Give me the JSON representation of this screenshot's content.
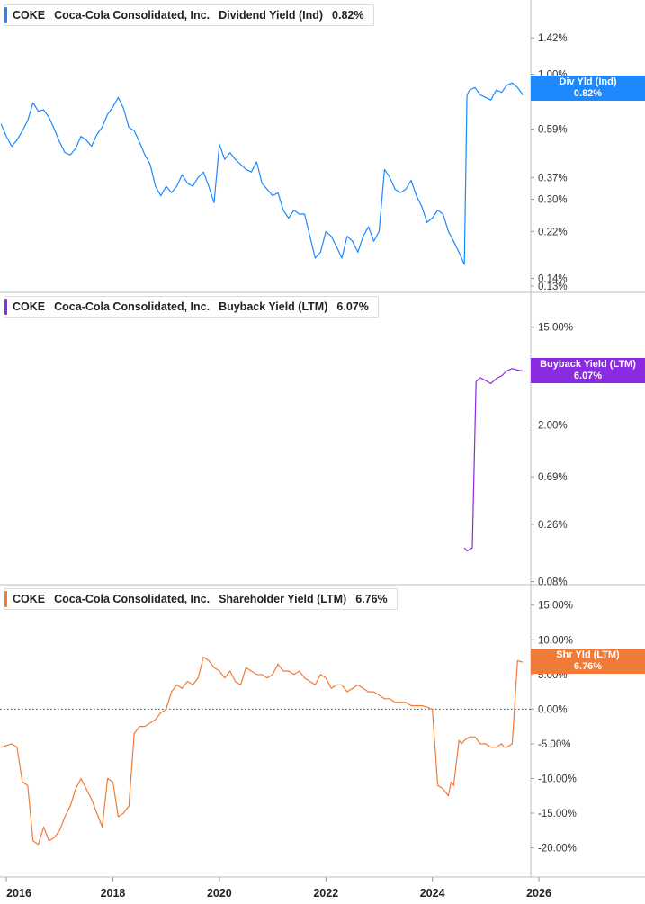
{
  "ticker": "COKE",
  "company": "Coca-Cola Consolidated, Inc.",
  "colors": {
    "div": "#1e88ff",
    "buyback": "#8a2be2",
    "shareholder": "#f07a38"
  },
  "panels": [
    {
      "metric": "Dividend Yield (Ind)",
      "value": "0.82%",
      "badge_line1": "Div Yld (Ind)",
      "badge_line2": "0.82%"
    },
    {
      "metric": "Buyback Yield (LTM)",
      "value": "6.07%",
      "badge_line1": "Buyback Yield (LTM)",
      "badge_line2": "6.07%"
    },
    {
      "metric": "Shareholder Yield (LTM)",
      "value": "6.76%",
      "badge_line1": "Shr Yld (LTM)",
      "badge_line2": "6.76%"
    }
  ],
  "chart_data": [
    {
      "type": "line",
      "title": "Dividend Yield (Ind)",
      "scale": "log",
      "ylim": [
        0.13,
        1.75
      ],
      "yticks": [
        "1.42%",
        "1.00%",
        "0.81%",
        "0.59%",
        "0.37%",
        "0.30%",
        "0.22%",
        "0.14%",
        "0.13%"
      ],
      "ytick_values": [
        1.42,
        1.0,
        0.81,
        0.59,
        0.37,
        0.3,
        0.22,
        0.14,
        0.13
      ],
      "last_value": 0.82,
      "x": [
        2015.9,
        2016.0,
        2016.1,
        2016.2,
        2016.3,
        2016.4,
        2016.5,
        2016.6,
        2016.7,
        2016.8,
        2016.9,
        2017.0,
        2017.1,
        2017.2,
        2017.3,
        2017.4,
        2017.5,
        2017.6,
        2017.7,
        2017.8,
        2017.9,
        2018.0,
        2018.1,
        2018.2,
        2018.3,
        2018.4,
        2018.5,
        2018.6,
        2018.7,
        2018.8,
        2018.9,
        2019.0,
        2019.1,
        2019.2,
        2019.3,
        2019.4,
        2019.5,
        2019.6,
        2019.7,
        2019.8,
        2019.9,
        2020.0,
        2020.1,
        2020.2,
        2020.3,
        2020.4,
        2020.5,
        2020.6,
        2020.7,
        2020.8,
        2020.9,
        2021.0,
        2021.1,
        2021.2,
        2021.3,
        2021.4,
        2021.5,
        2021.6,
        2021.7,
        2021.8,
        2021.9,
        2022.0,
        2022.1,
        2022.2,
        2022.3,
        2022.4,
        2022.5,
        2022.6,
        2022.7,
        2022.8,
        2022.9,
        2023.0,
        2023.1,
        2023.2,
        2023.3,
        2023.4,
        2023.5,
        2023.6,
        2023.7,
        2023.8,
        2023.9,
        2024.0,
        2024.1,
        2024.2,
        2024.3,
        2024.4,
        2024.5,
        2024.6,
        2024.65,
        2024.7,
        2024.8,
        2024.9,
        2025.0,
        2025.1,
        2025.2,
        2025.3,
        2025.4,
        2025.5,
        2025.6,
        2025.7
      ],
      "y": [
        0.62,
        0.55,
        0.5,
        0.53,
        0.58,
        0.64,
        0.76,
        0.7,
        0.71,
        0.66,
        0.59,
        0.52,
        0.47,
        0.46,
        0.49,
        0.55,
        0.53,
        0.5,
        0.56,
        0.6,
        0.68,
        0.73,
        0.8,
        0.72,
        0.6,
        0.58,
        0.52,
        0.46,
        0.42,
        0.34,
        0.31,
        0.34,
        0.32,
        0.34,
        0.38,
        0.35,
        0.34,
        0.37,
        0.39,
        0.34,
        0.29,
        0.51,
        0.44,
        0.47,
        0.44,
        0.42,
        0.4,
        0.39,
        0.43,
        0.35,
        0.33,
        0.31,
        0.32,
        0.27,
        0.25,
        0.27,
        0.26,
        0.26,
        0.21,
        0.17,
        0.18,
        0.22,
        0.21,
        0.19,
        0.17,
        0.21,
        0.2,
        0.18,
        0.21,
        0.23,
        0.2,
        0.22,
        0.4,
        0.37,
        0.33,
        0.32,
        0.33,
        0.36,
        0.31,
        0.28,
        0.24,
        0.25,
        0.27,
        0.26,
        0.22,
        0.2,
        0.18,
        0.16,
        0.82,
        0.86,
        0.88,
        0.82,
        0.8,
        0.78,
        0.86,
        0.84,
        0.9,
        0.92,
        0.88,
        0.82
      ]
    },
    {
      "type": "line",
      "title": "Buyback Yield (LTM)",
      "scale": "log",
      "ylim": [
        0.075,
        22
      ],
      "yticks": [
        "15.00%",
        "2.00%",
        "0.69%",
        "0.26%",
        "0.08%"
      ],
      "ytick_values": [
        15.0,
        2.0,
        0.69,
        0.26,
        0.08
      ],
      "last_value": 6.07,
      "x": [
        2024.6,
        2024.65,
        2024.7,
        2024.75,
        2024.82,
        2024.9,
        2025.0,
        2025.1,
        2025.2,
        2025.3,
        2025.4,
        2025.5,
        2025.6,
        2025.7
      ],
      "y": [
        0.16,
        0.15,
        0.155,
        0.16,
        4.9,
        5.3,
        5.0,
        4.7,
        5.2,
        5.5,
        6.1,
        6.4,
        6.2,
        6.07
      ]
    },
    {
      "type": "line",
      "title": "Shareholder Yield (LTM)",
      "ylim": [
        -22,
        16
      ],
      "yticks": [
        "15.00%",
        "10.00%",
        "5.00%",
        "0.00%",
        "-5.00%",
        "-10.00%",
        "-15.00%",
        "-20.00%"
      ],
      "ytick_values": [
        15,
        10,
        5,
        0,
        -5,
        -10,
        -15,
        -20
      ],
      "last_value": 6.76,
      "x": [
        2015.9,
        2016.1,
        2016.2,
        2016.3,
        2016.4,
        2016.5,
        2016.6,
        2016.7,
        2016.8,
        2016.9,
        2017.0,
        2017.1,
        2017.2,
        2017.3,
        2017.4,
        2017.5,
        2017.6,
        2017.7,
        2017.8,
        2017.9,
        2018.0,
        2018.1,
        2018.2,
        2018.3,
        2018.4,
        2018.5,
        2018.6,
        2018.7,
        2018.8,
        2018.9,
        2019.0,
        2019.1,
        2019.2,
        2019.3,
        2019.4,
        2019.5,
        2019.6,
        2019.7,
        2019.8,
        2019.9,
        2020.0,
        2020.1,
        2020.2,
        2020.3,
        2020.4,
        2020.5,
        2020.6,
        2020.7,
        2020.8,
        2020.9,
        2021.0,
        2021.1,
        2021.2,
        2021.3,
        2021.4,
        2021.5,
        2021.6,
        2021.7,
        2021.8,
        2021.9,
        2022.0,
        2022.1,
        2022.2,
        2022.3,
        2022.4,
        2022.5,
        2022.6,
        2022.7,
        2022.8,
        2022.9,
        2023.0,
        2023.1,
        2023.2,
        2023.3,
        2023.4,
        2023.5,
        2023.6,
        2023.7,
        2023.8,
        2023.9,
        2024.0,
        2024.1,
        2024.2,
        2024.3,
        2024.35,
        2024.4,
        2024.5,
        2024.55,
        2024.6,
        2024.7,
        2024.8,
        2024.9,
        2025.0,
        2025.1,
        2025.2,
        2025.3,
        2025.35,
        2025.4,
        2025.5,
        2025.6,
        2025.7
      ],
      "y": [
        -5.5,
        -5.0,
        -5.5,
        -10.5,
        -11.0,
        -19.0,
        -19.5,
        -17.0,
        -19.0,
        -18.5,
        -17.5,
        -15.5,
        -14.0,
        -11.5,
        -10.0,
        -11.5,
        -13.0,
        -15.0,
        -17.0,
        -10.0,
        -10.5,
        -15.5,
        -15.0,
        -14.0,
        -3.5,
        -2.5,
        -2.5,
        -2.0,
        -1.5,
        -0.5,
        0.0,
        2.5,
        3.5,
        3.0,
        4.0,
        3.5,
        4.5,
        7.5,
        7.0,
        6.0,
        5.5,
        4.5,
        5.5,
        4.0,
        3.5,
        6.0,
        5.5,
        5.0,
        5.0,
        4.5,
        5.0,
        6.5,
        5.5,
        5.5,
        5.0,
        5.5,
        4.5,
        4.0,
        3.5,
        5.0,
        4.5,
        3.0,
        3.5,
        3.5,
        2.5,
        3.0,
        3.5,
        3.0,
        2.5,
        2.5,
        2.0,
        1.5,
        1.5,
        1.0,
        1.0,
        1.0,
        0.5,
        0.5,
        0.5,
        0.3,
        0.0,
        -11.0,
        -11.5,
        -12.5,
        -10.5,
        -11.0,
        -4.5,
        -5.0,
        -4.5,
        -4.0,
        -4.0,
        -5.0,
        -5.0,
        -5.5,
        -5.5,
        -5.0,
        -5.5,
        -5.5,
        -5.0,
        7.0,
        6.76
      ]
    }
  ],
  "x_axis": {
    "ticks": [
      "2016",
      "2018",
      "2020",
      "2022",
      "2024",
      "2026"
    ],
    "tick_values": [
      2016,
      2018,
      2020,
      2022,
      2024,
      2026
    ]
  }
}
